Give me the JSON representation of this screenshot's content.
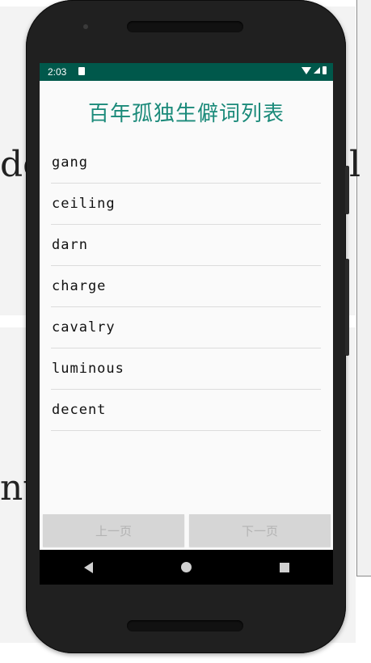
{
  "background": {
    "fragment_left_top": "de",
    "fragment_left_bottom": "nt",
    "fragment_right": "l"
  },
  "status_bar": {
    "time": "2:03",
    "icons": [
      "sd-card-icon",
      "wifi-icon",
      "signal-icon",
      "battery-icon"
    ],
    "color": "#00584b"
  },
  "app": {
    "title": "百年孤独生僻词列表",
    "title_color": "#1b8a7a",
    "words": [
      "gang",
      "ceiling",
      "darn",
      "charge",
      "cavalry",
      "luminous",
      "decent"
    ],
    "prev_label": "上一页",
    "next_label": "下一页"
  },
  "system_nav": {
    "icons": [
      "back-icon",
      "home-icon",
      "recent-apps-icon"
    ]
  }
}
